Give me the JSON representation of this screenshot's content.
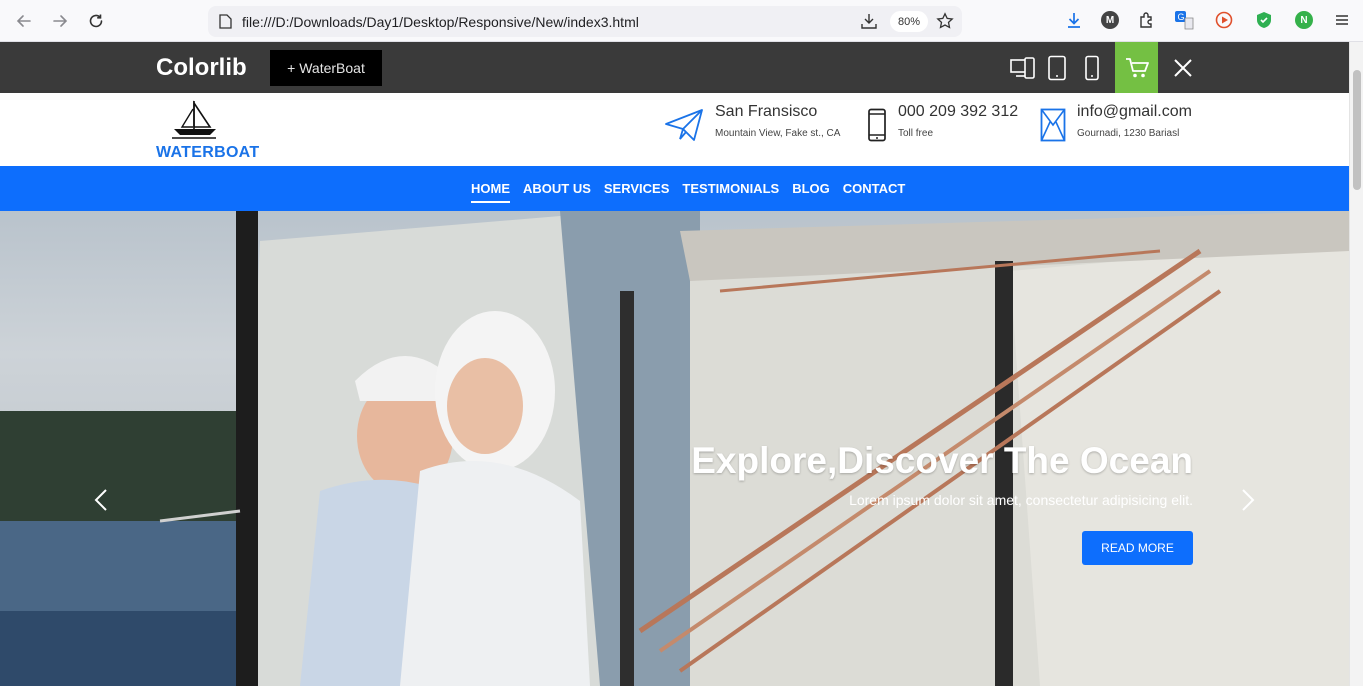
{
  "browser": {
    "url": "file:///D:/Downloads/Day1/Desktop/Responsive/New/index3.html",
    "zoom": "80%",
    "nav_icons": [
      "back-icon",
      "forward-icon",
      "reload-icon"
    ],
    "extension_icons": [
      "download-icon",
      "m-extension-icon",
      "puzzle-icon",
      "translate-icon",
      "play-icon",
      "shield-icon",
      "n-extension-icon",
      "menu-icon"
    ],
    "ext_m": "M",
    "ext_n": "N"
  },
  "topbar": {
    "brand": "Colorlib",
    "theme_button": "+ WaterBoat",
    "cart_color": "#74c043"
  },
  "header": {
    "logo_text": "WATERBOAT",
    "contacts": [
      {
        "icon": "paper-plane-icon",
        "title": "San Fransisco",
        "sub": "Mountain View, Fake st., CA"
      },
      {
        "icon": "phone-icon",
        "title": "000 209 392 312",
        "sub": "Toll free"
      },
      {
        "icon": "envelope-icon",
        "title": "info@gmail.com",
        "sub": "Gournadi, 1230 Bariasl"
      }
    ]
  },
  "nav": {
    "items": [
      "HOME",
      "ABOUT US",
      "SERVICES",
      "TESTIMONIALS",
      "BLOG",
      "CONTACT"
    ],
    "active": "HOME",
    "color": "#0d6efd"
  },
  "hero": {
    "title": "Explore,Discover The Ocean",
    "subtitle": "Lorem ipsum dolor sit amet, consectetur adipisicing elit.",
    "button": "READ MORE"
  }
}
